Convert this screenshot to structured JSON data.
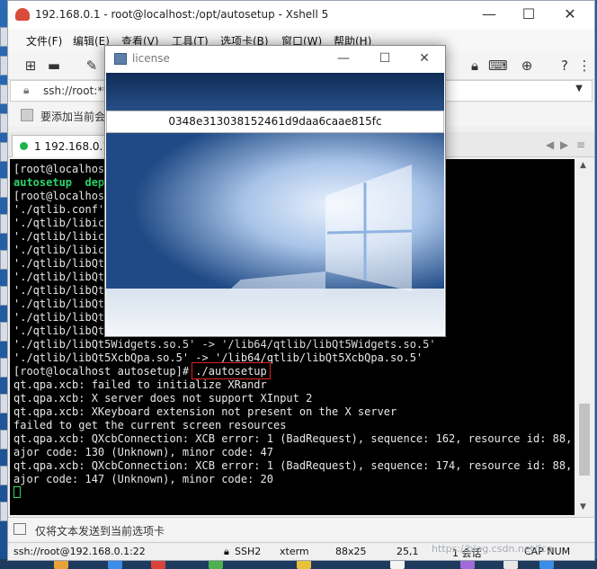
{
  "window": {
    "title": "192.168.0.1 - root@localhost:/opt/autosetup - Xshell 5",
    "controls": {
      "minimize": "—",
      "maximize": "☐",
      "close": "✕"
    }
  },
  "menu": [
    "文件(F)",
    "编辑(E)",
    "查看(V)",
    "工具(T)",
    "选项卡(B)",
    "窗口(W)",
    "帮助(H)"
  ],
  "address": {
    "text": "ssh://root:**",
    "icon": "lock-icon"
  },
  "links": {
    "text": "要添加当前会"
  },
  "tabs": {
    "active_label": "1 192.168.0.1",
    "status_color": "#1cb44a"
  },
  "terminal": {
    "lines": [
      "[root@localhost",
      "autosetup  depl",
      "[root@localhost",
      "'./qtlib.conf'",
      "'./qtlib/libicu",
      "'./qtlib/libicu",
      "'./qtlib/libicu",
      "'./qtlib/libQt5",
      "'./qtlib/libQt5",
      "'./qtlib/libQt5",
      "'./qtlib/libQt5",
      "'./qtlib/libQt5",
      "'./qtlib/libQt5",
      "'./qtlib/libQt5Widgets.so.5' -> '/lib64/qtlib/libQt5Widgets.so.5'",
      "'./qtlib/libQt5XcbQpa.so.5' -> '/lib64/qtlib/libQt5XcbQpa.so.5'",
      "[root@localhost autosetup]# ./autosetup",
      "qt.qpa.xcb: failed to initialize XRandr",
      "qt.qpa.xcb: X server does not support XInput 2",
      "qt.qpa.xcb: XKeyboard extension not present on the X server",
      "failed to get the current screen resources",
      "qt.qpa.xcb: QXcbConnection: XCB error: 1 (BadRequest), sequence: 162, resource id: 88, m",
      "ajor code: 130 (Unknown), minor code: 47",
      "qt.qpa.xcb: QXcbConnection: XCB error: 1 (BadRequest), sequence: 174, resource id: 88, m",
      "ajor code: 147 (Unknown), minor code: 20"
    ],
    "highlight_word": "autosetup",
    "highlight_color": "#2bd56a"
  },
  "sendbar": {
    "text": "仅将文本发送到当前选项卡"
  },
  "status": {
    "connection": "ssh://root@192.168.0.1:22",
    "protocol": "SSH2",
    "term": "xterm",
    "size": "88x25",
    "pos": "25,1",
    "sessions": "1 会话",
    "caps": "CAP NUM",
    "watermark": "https://blog.csdn.net/fcq"
  },
  "dialog": {
    "title": "license",
    "license_key": "0348e313038152461d9daa6caae815fc",
    "controls": {
      "minimize": "—",
      "maximize": "☐",
      "close": "✕"
    }
  },
  "colors": {
    "accent": "#1d5ea8",
    "terminal_bg": "#000000",
    "highlight_box": "#e02020"
  }
}
